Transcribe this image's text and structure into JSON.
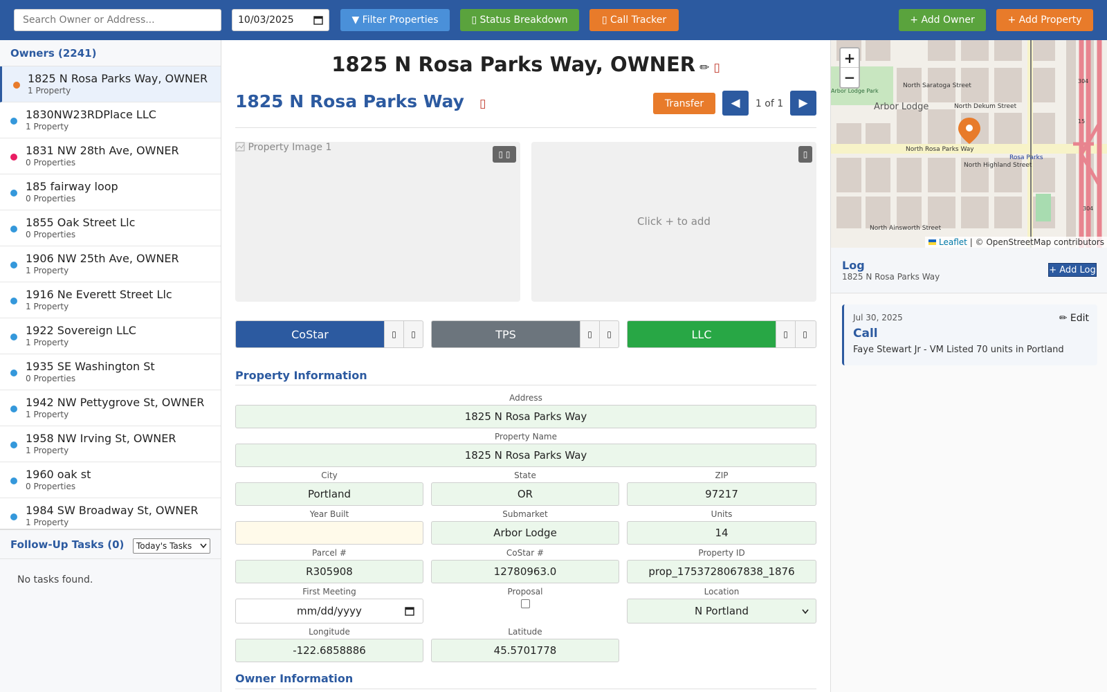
{
  "topbar": {
    "search_placeholder": "Search Owner or Address...",
    "date_value": "10/03/2025",
    "filter_label": "▼ Filter Properties",
    "status_label": "▯ Status Breakdown",
    "call_label": "▯ Call Tracker",
    "add_owner_label": "+ Add Owner",
    "add_property_label": "+ Add Property"
  },
  "owners": {
    "header": "Owners (2241)",
    "items": [
      {
        "name": "1825 N Rosa Parks Way, OWNER",
        "count": "1 Property",
        "color": "#e87b2a"
      },
      {
        "name": "1830NW23RDPlace LLC",
        "count": "1 Property",
        "color": "#3498db"
      },
      {
        "name": "1831 NW 28th Ave, OWNER",
        "count": "0 Properties",
        "color": "#e91e63"
      },
      {
        "name": "185 fairway loop",
        "count": "0 Properties",
        "color": "#3498db"
      },
      {
        "name": "1855 Oak Street Llc",
        "count": "0 Properties",
        "color": "#3498db"
      },
      {
        "name": "1906 NW 25th Ave, OWNER",
        "count": "1 Property",
        "color": "#3498db"
      },
      {
        "name": "1916 Ne Everett Street Llc",
        "count": "1 Property",
        "color": "#3498db"
      },
      {
        "name": "1922 Sovereign LLC",
        "count": "1 Property",
        "color": "#3498db"
      },
      {
        "name": "1935 SE Washington St",
        "count": "0 Properties",
        "color": "#3498db"
      },
      {
        "name": "1942 NW Pettygrove St, OWNER",
        "count": "1 Property",
        "color": "#3498db"
      },
      {
        "name": "1958 NW Irving St, OWNER",
        "count": "1 Property",
        "color": "#3498db"
      },
      {
        "name": "1960 oak st",
        "count": "0 Properties",
        "color": "#3498db"
      },
      {
        "name": "1984 SW Broadway St, OWNER",
        "count": "1 Property",
        "color": "#3498db"
      }
    ]
  },
  "followup": {
    "title": "Follow-Up Tasks (0)",
    "filter_value": "Today's Tasks",
    "empty_text": "No tasks found."
  },
  "detail": {
    "owner_title": "1825 N Rosa Parks Way, OWNER",
    "owner_edit_icon": "✏",
    "owner_delete_icon": "▯",
    "property_title": "1825 N Rosa Parks Way",
    "property_delete_icon": "▯",
    "transfer_label": "Transfer",
    "prev_label": "◀",
    "next_label": "▶",
    "pager": "1 of 1",
    "image_alt": "Property Image 1",
    "image_tools": "▯ ▯",
    "image2_tool": "▯",
    "image_add_text": "Click + to add",
    "segments": [
      {
        "label": "CoStar",
        "color": "#2c5aa0",
        "icon_a": "▯",
        "icon_b": "▯"
      },
      {
        "label": "TPS",
        "color": "#6c757d",
        "icon_a": "▯",
        "icon_b": "▯"
      },
      {
        "label": "LLC",
        "color": "#28a745",
        "icon_a": "▯",
        "icon_b": "▯"
      }
    ],
    "section_property": "Property Information",
    "section_owner": "Owner Information",
    "fields": {
      "address_label": "Address",
      "address": "1825 N Rosa Parks Way",
      "propname_label": "Property Name",
      "propname": "1825 N Rosa Parks Way",
      "city_label": "City",
      "city": "Portland",
      "state_label": "State",
      "state": "OR",
      "zip_label": "ZIP",
      "zip": "97217",
      "yearbuilt_label": "Year Built",
      "yearbuilt": "",
      "submarket_label": "Submarket",
      "submarket": "Arbor Lodge",
      "units_label": "Units",
      "units": "14",
      "parcel_label": "Parcel #",
      "parcel": "R305908",
      "costar_label": "CoStar #",
      "costar": "12780963.0",
      "propid_label": "Property ID",
      "propid": "prop_1753728067838_1876",
      "firstmeeting_label": "First Meeting",
      "firstmeeting_placeholder": "mm/dd/yyyy",
      "proposal_label": "Proposal",
      "location_label": "Location",
      "location": "N Portland",
      "longitude_label": "Longitude",
      "longitude": "-122.6858886",
      "latitude_label": "Latitude",
      "latitude": "45.5701778"
    }
  },
  "map": {
    "zoom_in": "+",
    "zoom_out": "−",
    "attrib_leaflet": "Leaflet",
    "attrib_rest": " | © OpenStreetMap contributors",
    "labels": {
      "neighborhood": "Arbor Lodge",
      "rosa_parks_way": "North Rosa Parks Way",
      "rosa_parks": "Rosa Parks",
      "saratoga": "North Saratoga Street",
      "dekum": "North Dekum Street",
      "highland": "North Highland Street",
      "ainsworth": "North Ainsworth Street",
      "park": "Arbor Lodge Park",
      "hw15": "15",
      "hw304a": "304",
      "hw304b": "304"
    }
  },
  "log": {
    "title": "Log",
    "subtitle": "1825 N Rosa Parks Way",
    "add_label": "+ Add Log",
    "entries": [
      {
        "date": "Jul 30, 2025",
        "edit": "✏ Edit",
        "type": "Call",
        "note": "Faye Stewart Jr - VM Listed 70 units in Portland"
      }
    ]
  }
}
